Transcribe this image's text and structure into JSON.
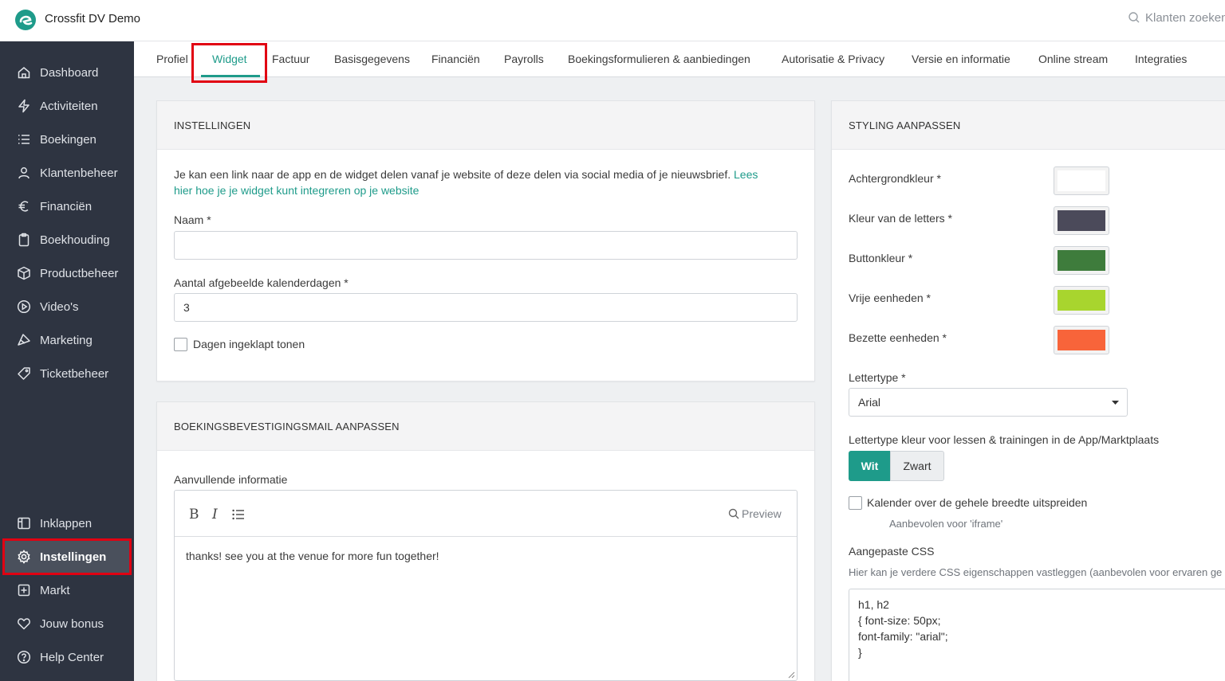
{
  "app": {
    "name": "Crossfit DV Demo",
    "search_placeholder": "Klanten zoeken",
    "accent": "#1e9b8a"
  },
  "sidebar": {
    "items": [
      {
        "label": "Dashboard",
        "icon": "home-icon"
      },
      {
        "label": "Activiteiten",
        "icon": "bolt-icon"
      },
      {
        "label": "Boekingen",
        "icon": "list-icon"
      },
      {
        "label": "Klantenbeheer",
        "icon": "user-icon"
      },
      {
        "label": "Financiën",
        "icon": "euro-icon"
      },
      {
        "label": "Boekhouding",
        "icon": "clipboard-icon"
      },
      {
        "label": "Productbeheer",
        "icon": "package-icon"
      },
      {
        "label": "Video's",
        "icon": "play-icon"
      },
      {
        "label": "Marketing",
        "icon": "megaphone-icon"
      },
      {
        "label": "Ticketbeheer",
        "icon": "tag-icon"
      }
    ],
    "bottom_items": [
      {
        "label": "Inklappen",
        "icon": "collapse-icon"
      },
      {
        "label": "Instellingen",
        "icon": "gear-icon",
        "active": true
      },
      {
        "label": "Markt",
        "icon": "plus-square-icon"
      },
      {
        "label": "Jouw bonus",
        "icon": "heart-icon"
      },
      {
        "label": "Help Center",
        "icon": "help-icon"
      }
    ]
  },
  "tabs": [
    {
      "label": "Profiel"
    },
    {
      "label": "Widget",
      "active": true
    },
    {
      "label": "Factuur"
    },
    {
      "label": "Basisgegevens"
    },
    {
      "label": "Financiën"
    },
    {
      "label": "Payrolls"
    },
    {
      "label": "Boekingsformulieren & aanbiedingen"
    },
    {
      "label": "Autorisatie & Privacy"
    },
    {
      "label": "Versie en informatie"
    },
    {
      "label": "Online stream"
    },
    {
      "label": "Integraties"
    }
  ],
  "instellingen": {
    "title": "INSTELLINGEN",
    "intro_line1": "Je kan een link naar de app en de widget delen vanaf je website of deze delen via social media of je nieuwsbrief.",
    "intro_link_part1": "Lees",
    "intro_link_part2": "hier hoe je je widget kunt integreren op je website",
    "naam_label": "Naam *",
    "naam_value": "",
    "dagen_label": "Aantal afgebeelde kalenderdagen *",
    "dagen_value": "3",
    "ingeklapt_label": "Dagen ingeklapt tonen",
    "ingeklapt_checked": false
  },
  "mail": {
    "title": "BOEKINGSBEVESTIGINGSMAIL AANPASSEN",
    "aanvullend_label": "Aanvullende informatie",
    "bold": "B",
    "italic": "I",
    "preview_label": "Preview",
    "content": "thanks! see you at the venue for more fun together!"
  },
  "styling": {
    "title": "STYLING AANPASSEN",
    "colors": [
      {
        "label": "Achtergrondkleur *",
        "color": "#ffffff"
      },
      {
        "label": "Kleur van de letters *",
        "color": "#4b4a5a"
      },
      {
        "label": "Buttonkleur *",
        "color": "#3e7c3c"
      },
      {
        "label": "Vrije eenheden *",
        "color": "#a8d52e"
      },
      {
        "label": "Bezette eenheden *",
        "color": "#f8643a"
      }
    ],
    "lettertype_label": "Lettertype *",
    "lettertype_value": "Arial",
    "kleur_label": "Lettertype kleur voor lessen & trainingen in de App/Marktplaats",
    "option_wit": "Wit",
    "option_zwart": "Zwart",
    "selected_option": "Wit",
    "kalender_label": "Kalender over de gehele breedte uitspreiden",
    "kalender_checked": false,
    "kalender_hint": "Aanbevolen voor 'iframe'",
    "css_label": "Aangepaste CSS",
    "css_hint": "Hier kan je verdere CSS eigenschappen vastleggen (aanbevolen voor ervaren ge",
    "css_lines": [
      "h1, h2",
      "{ font-size: 50px;",
      "font-family: \"arial\";",
      "}"
    ]
  }
}
